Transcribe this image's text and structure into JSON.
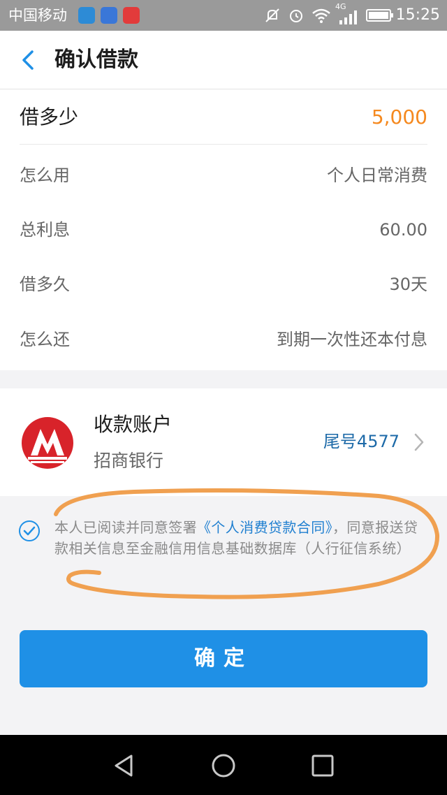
{
  "status_bar": {
    "carrier": "中国移动",
    "network": "4G",
    "time": "15:25"
  },
  "header": {
    "back_icon": "chevron-left-icon",
    "title": "确认借款"
  },
  "loan": {
    "rows": [
      {
        "label": "借多少",
        "value": "5,000"
      },
      {
        "label": "怎么用",
        "value": "个人日常消费"
      },
      {
        "label": "总利息",
        "value": "60.00"
      },
      {
        "label": "借多久",
        "value": "30天"
      },
      {
        "label": "怎么还",
        "value": "到期一次性还本付息"
      }
    ]
  },
  "account": {
    "title": "收款账户",
    "bank": "招商银行",
    "tail": "尾号4577",
    "logo_icon": "cmb-bank-logo-icon"
  },
  "agreement": {
    "prefix": "本人已阅读并同意签署",
    "link": "《个人消费贷款合同》",
    "suffix": "，同意报送贷款相关信息至金融信用信息基础数据库（人行征信系统）"
  },
  "confirm": {
    "label": "确定"
  },
  "colors": {
    "accent": "#1f90e6",
    "amount": "#f5891f",
    "link": "#1f7fd0",
    "annotation": "#f0a050"
  }
}
